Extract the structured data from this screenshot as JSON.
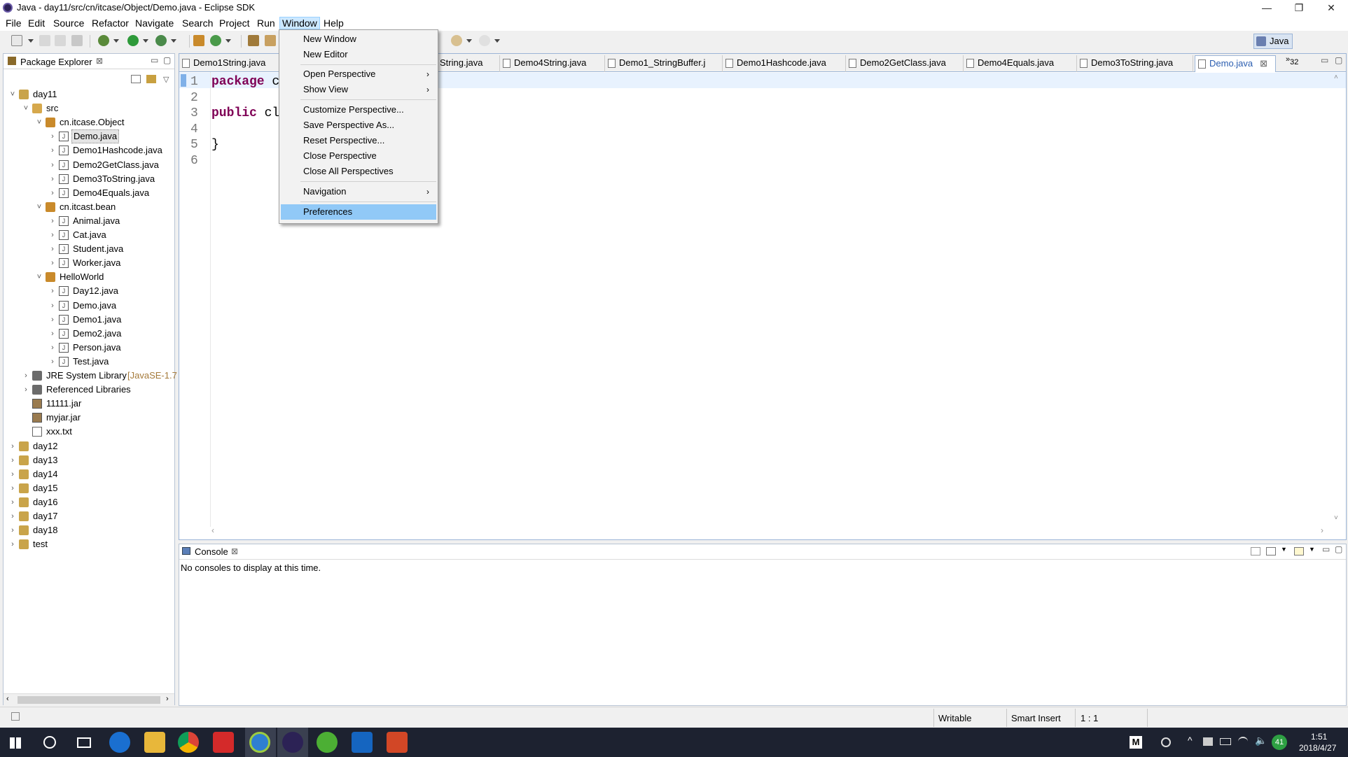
{
  "window": {
    "title": "Java - day11/src/cn/itcase/Object/Demo.java - Eclipse SDK",
    "minimize": "—",
    "restore": "❐",
    "close": "✕"
  },
  "menubar": [
    "File",
    "Edit",
    "Source",
    "Refactor",
    "Navigate",
    "Search",
    "Project",
    "Run",
    "Window",
    "Help"
  ],
  "perspective": {
    "label": "Java"
  },
  "window_menu": {
    "items": [
      "New Window",
      "New Editor",
      "Open Perspective",
      "Show View",
      "Customize Perspective...",
      "Save Perspective As...",
      "Reset Perspective...",
      "Close Perspective",
      "Close All Perspectives",
      "Navigation",
      "Preferences"
    ],
    "highlighted": "Preferences"
  },
  "package_explorer": {
    "title": "Package Explorer",
    "tree": [
      {
        "label": "day11",
        "kind": "project",
        "depth": 0,
        "expanded": true
      },
      {
        "label": "src",
        "kind": "src",
        "depth": 1,
        "expanded": true
      },
      {
        "label": "cn.itcase.Object",
        "kind": "pkg",
        "depth": 2,
        "expanded": true
      },
      {
        "label": "Demo.java",
        "kind": "java",
        "depth": 3,
        "selected": true
      },
      {
        "label": "Demo1Hashcode.java",
        "kind": "java",
        "depth": 3
      },
      {
        "label": "Demo2GetClass.java",
        "kind": "java",
        "depth": 3
      },
      {
        "label": "Demo3ToString.java",
        "kind": "java",
        "depth": 3
      },
      {
        "label": "Demo4Equals.java",
        "kind": "java",
        "depth": 3
      },
      {
        "label": "cn.itcast.bean",
        "kind": "pkg",
        "depth": 2,
        "expanded": true
      },
      {
        "label": "Animal.java",
        "kind": "java",
        "depth": 3
      },
      {
        "label": "Cat.java",
        "kind": "java",
        "depth": 3
      },
      {
        "label": "Student.java",
        "kind": "java",
        "depth": 3
      },
      {
        "label": "Worker.java",
        "kind": "java",
        "depth": 3
      },
      {
        "label": "HelloWorld",
        "kind": "pkg",
        "depth": 2,
        "expanded": true
      },
      {
        "label": "Day12.java",
        "kind": "java",
        "depth": 3
      },
      {
        "label": "Demo.java",
        "kind": "java",
        "depth": 3
      },
      {
        "label": "Demo1.java",
        "kind": "java",
        "depth": 3
      },
      {
        "label": "Demo2.java",
        "kind": "java",
        "depth": 3
      },
      {
        "label": "Person.java",
        "kind": "java",
        "depth": 3
      },
      {
        "label": "Test.java",
        "kind": "java",
        "depth": 3
      },
      {
        "label": "JRE System Library",
        "suffix": "[JavaSE-1.7",
        "kind": "lib",
        "depth": 1
      },
      {
        "label": "Referenced Libraries",
        "kind": "lib",
        "depth": 1
      },
      {
        "label": "11111.jar",
        "kind": "jar",
        "depth": 1,
        "leaf": true
      },
      {
        "label": "myjar.jar",
        "kind": "jar",
        "depth": 1,
        "leaf": true
      },
      {
        "label": "xxx.txt",
        "kind": "txt",
        "depth": 1,
        "leaf": true
      },
      {
        "label": "day12",
        "kind": "project",
        "depth": 0
      },
      {
        "label": "day13",
        "kind": "project",
        "depth": 0
      },
      {
        "label": "day14",
        "kind": "project",
        "depth": 0
      },
      {
        "label": "day15",
        "kind": "project",
        "depth": 0
      },
      {
        "label": "day16",
        "kind": "project",
        "depth": 0
      },
      {
        "label": "day17",
        "kind": "project",
        "depth": 0
      },
      {
        "label": "day18",
        "kind": "project",
        "depth": 0
      },
      {
        "label": "test",
        "kind": "project",
        "depth": 0
      }
    ]
  },
  "editor": {
    "tabs": [
      "Demo1String.java",
      "String.java",
      "Demo4String.java",
      "Demo1_StringBuffer.j",
      "Demo1Hashcode.java",
      "Demo2GetClass.java",
      "Demo4Equals.java",
      "Demo3ToString.java",
      "Demo.java"
    ],
    "active_tab": "Demo.java",
    "overflow_count": "32",
    "lines": [
      {
        "n": "1",
        "kw": "package",
        "rest": " c"
      },
      {
        "n": "2",
        "kw": "",
        "rest": ""
      },
      {
        "n": "3",
        "kw": "public",
        "rest": " cl"
      },
      {
        "n": "4",
        "kw": "",
        "rest": ""
      },
      {
        "n": "5",
        "kw": "",
        "rest": "}"
      },
      {
        "n": "6",
        "kw": "",
        "rest": ""
      }
    ]
  },
  "console": {
    "title": "Console",
    "message": "No consoles to display at this time."
  },
  "statusbar": {
    "mode": "Writable",
    "insert": "Smart Insert",
    "position": "1 : 1"
  },
  "taskbar": {
    "time": "1:51",
    "date": "2018/4/27",
    "badge": "41"
  },
  "colors": {
    "accent": "#91c9f7",
    "keyword": "#7f0055",
    "taskbar": "#1d2230"
  }
}
